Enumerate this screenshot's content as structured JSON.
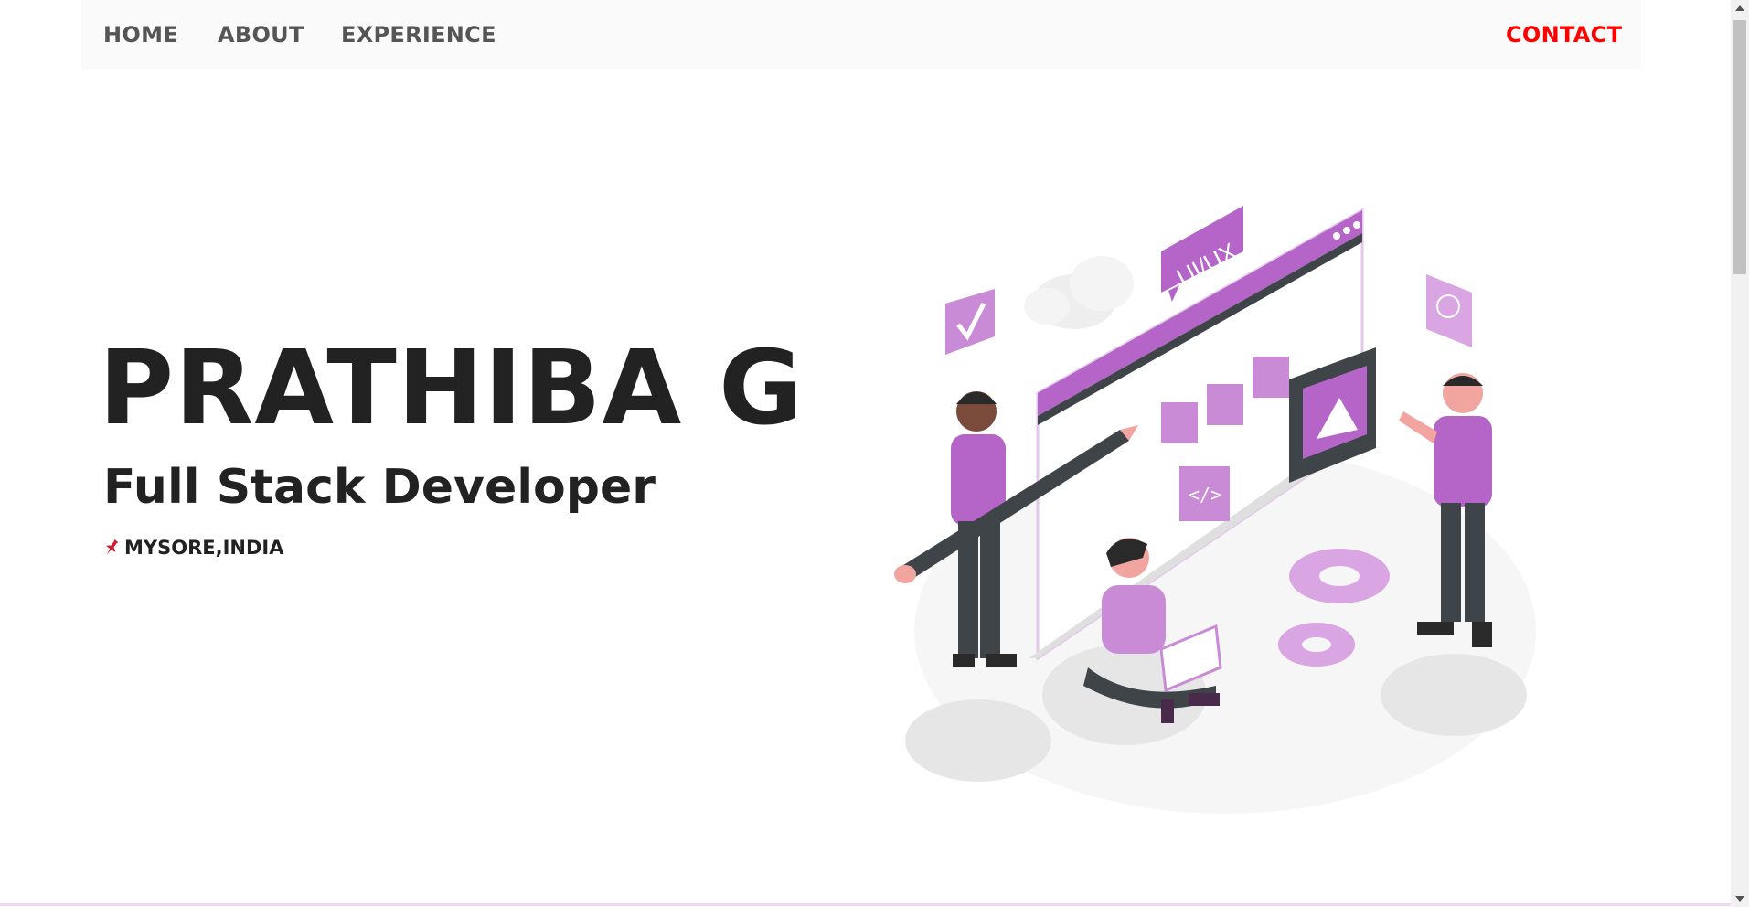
{
  "nav": {
    "home": "HOME",
    "about": "ABOUT",
    "experience": "EXPERIENCE",
    "contact": "CONTACT"
  },
  "hero": {
    "name": "PRATHIBA G",
    "role": "Full Stack Developer",
    "location": "MYSORE,INDIA",
    "location_icon": "pushpin-icon"
  },
  "illustration": {
    "badge_text": "UI/UX",
    "subject": "ui-ux-design-team-illustration"
  },
  "colors": {
    "accent_purple": "#b565c8",
    "light_purple": "#d9a6e3",
    "contact_red": "#ff0000",
    "dark_text": "#222222",
    "nav_text": "#555555"
  }
}
